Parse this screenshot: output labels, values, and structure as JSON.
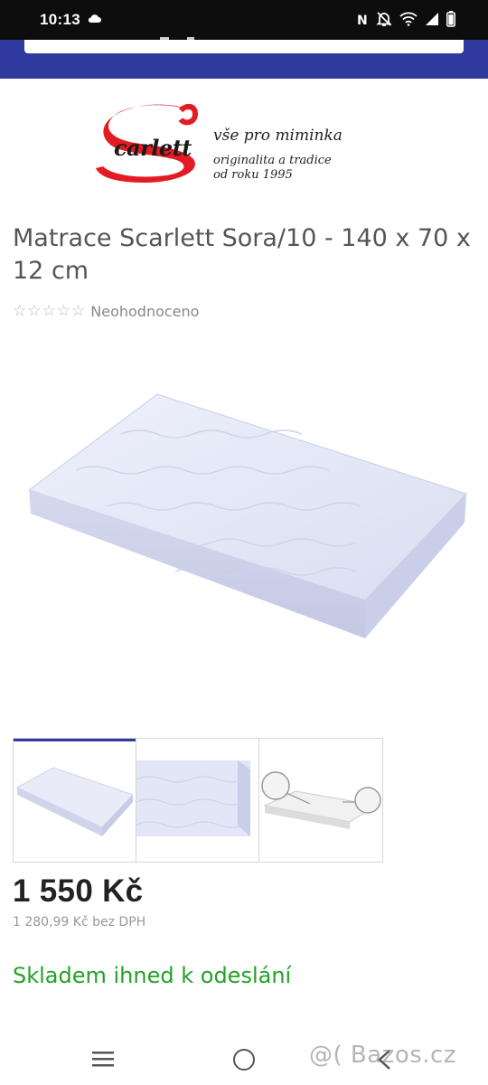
{
  "status_bar": {
    "time": "10:13",
    "icons": [
      "cloud-icon",
      "nfc-icon",
      "mute-icon",
      "wifi-icon",
      "signal-icon",
      "battery-icon"
    ]
  },
  "logo": {
    "tagline_1": "vše pro miminka",
    "tagline_2": "originalita a tradice",
    "tagline_3": "od roku 1995",
    "brand_color": "#e31b23"
  },
  "product": {
    "title": "Matrace Scarlett Sora/10 - 140 x 70 x 12 cm",
    "rating_stars": 0,
    "rating_text": "Neohodnoceno",
    "price": "1 550 Kč",
    "price_net": "1 280,99 Kč bez DPH",
    "stock": "Skladem ihned k odeslání"
  },
  "gallery": {
    "thumbnail_count": 3,
    "active_index": 0
  },
  "colors": {
    "header": "#2f3a9e",
    "stock_green": "#23a227",
    "price": "#222222"
  },
  "watermark": "@( Bazos.cz"
}
